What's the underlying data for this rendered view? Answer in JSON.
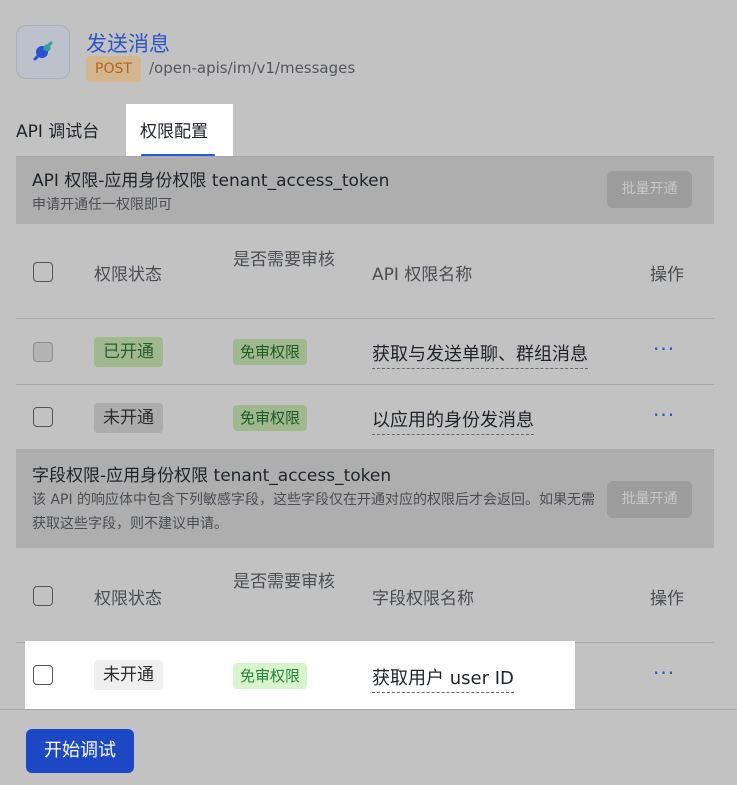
{
  "header": {
    "title": "发送消息",
    "method": "POST",
    "path": "/open-apis/im/v1/messages"
  },
  "tabs": [
    {
      "label": "API 调试台",
      "active": false
    },
    {
      "label": "权限配置",
      "active": true
    }
  ],
  "columns_api": {
    "status": "权限状态",
    "review": "是否需要审核",
    "name": "API 权限名称",
    "action": "操作"
  },
  "columns_field": {
    "status": "权限状态",
    "review": "是否需要审核",
    "name": "字段权限名称",
    "action": "操作"
  },
  "section_api": {
    "title": "API 权限-应用身份权限 tenant_access_token",
    "desc": "申请开通任一权限即可",
    "batch_button": "批量开通",
    "rows": [
      {
        "status": "已开通",
        "review": "免审权限",
        "name": "获取与发送单聊、群组消息",
        "more": "···"
      },
      {
        "status": "未开通",
        "review": "免审权限",
        "name": "以应用的身份发消息",
        "more": "···"
      }
    ]
  },
  "section_field": {
    "title": "字段权限-应用身份权限 tenant_access_token",
    "desc": "该 API 的响应体中包含下列敏感字段，这些字段仅在开通对应的权限后才会返回。如果无需获取这些字段，则不建议申请。",
    "batch_button": "批量开通",
    "rows": [
      {
        "status": "未开通",
        "review": "免审权限",
        "name": "获取用户 user ID",
        "more": "···"
      }
    ]
  },
  "footer": {
    "start_button": "开始调试"
  },
  "colors": {
    "accent": "#2358e0",
    "primary_button": "#1d48c5",
    "link": "#2d57c8"
  }
}
